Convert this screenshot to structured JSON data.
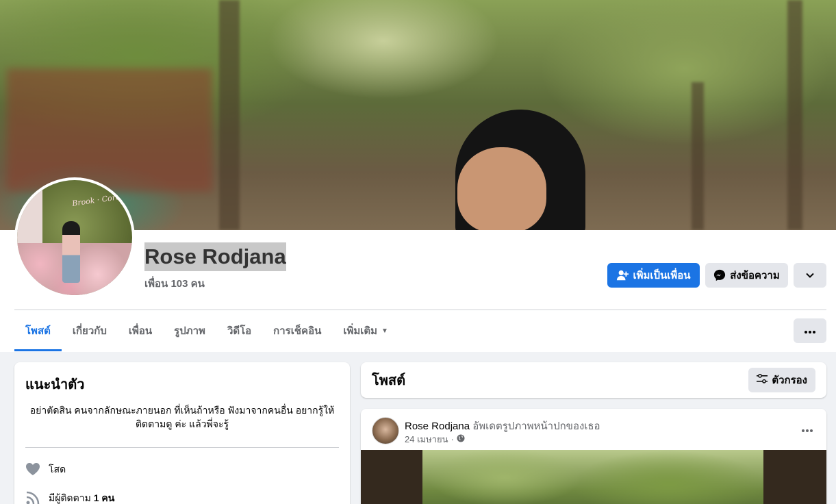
{
  "profile": {
    "name": "Rose Rodjana",
    "friends_count": "เพื่อน 103 คน"
  },
  "actions": {
    "add_friend": "เพิ่มเป็นเพื่อน",
    "message": "ส่งข้อความ"
  },
  "tabs": [
    {
      "label": "โพสต์",
      "active": true
    },
    {
      "label": "เกี่ยวกับ"
    },
    {
      "label": "เพื่อน"
    },
    {
      "label": "รูปภาพ"
    },
    {
      "label": "วิดีโอ"
    },
    {
      "label": "การเช็คอิน"
    },
    {
      "label": "เพิ่มเติม"
    }
  ],
  "intro": {
    "title": "แนะนำตัว",
    "bio": "อย่าตัดสิน คนจากลักษณะภายนอก ที่เห็นถ้าหรือ ฟังมาจากคนอื่น อยากรู้ให้ติดตามดู ค่ะ แล้วพี่จะรู้",
    "relationship": "โสด",
    "followers_prefix": "มีผู้ติดตาม",
    "followers_count": "1 คน"
  },
  "posts": {
    "title": "โพสต์",
    "filter_label": "ตัวกรอง",
    "first_post": {
      "author": "Rose Rodjana",
      "action": "อัพเดตรูปภาพหน้าปกของเธอ",
      "date": "24 เมษายน",
      "separator": "·"
    }
  },
  "colors": {
    "accent": "#1b74e4",
    "secondary_button": "#e4e6eb",
    "page_bg": "#f0f2f5"
  }
}
